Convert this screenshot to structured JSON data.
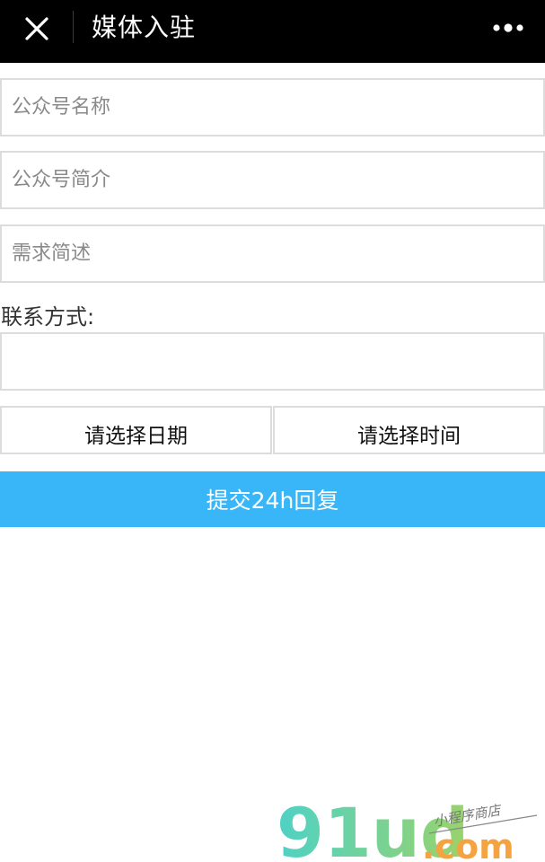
{
  "navbar": {
    "title": "媒体入驻",
    "close_icon": "close-icon",
    "more_icon": "more-dots-icon"
  },
  "form": {
    "name_placeholder": "公众号名称",
    "intro_placeholder": "公众号简介",
    "demand_placeholder": "需求简述",
    "contact_label": "联系方式:",
    "date_picker_label": "请选择日期",
    "time_picker_label": "请选择时间",
    "submit_label": "提交24h回复"
  },
  "watermark": {
    "brand": "91ud",
    "domain": ".com",
    "tagline": "小程序商店"
  },
  "colors": {
    "navbar_bg": "#000000",
    "submit_bg": "#38b6f7",
    "border": "#dcdcdc"
  }
}
